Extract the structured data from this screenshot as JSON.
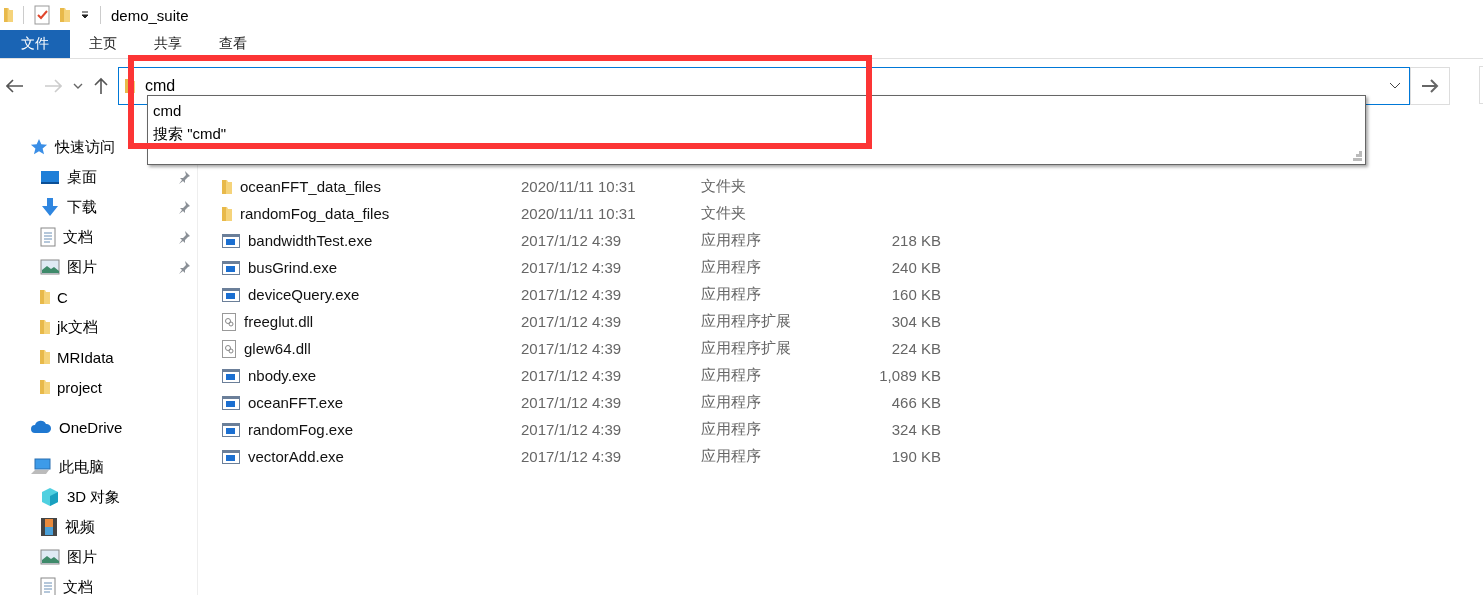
{
  "window": {
    "title": "demo_suite"
  },
  "ribbon_tabs": [
    {
      "label": "文件",
      "kind": "file"
    },
    {
      "label": "主页",
      "kind": "tab"
    },
    {
      "label": "共享",
      "kind": "tab"
    },
    {
      "label": "查看",
      "kind": "tab"
    }
  ],
  "address_bar": {
    "value": "cmd",
    "suggestions": [
      "cmd",
      "搜索 \"cmd\""
    ]
  },
  "sidebar": [
    {
      "label": "快速访问",
      "kind": "star",
      "children": [
        {
          "label": "桌面",
          "kind": "desktop",
          "pinned": true
        },
        {
          "label": "下载",
          "kind": "download",
          "pinned": true
        },
        {
          "label": "文档",
          "kind": "document",
          "pinned": true
        },
        {
          "label": "图片",
          "kind": "pictures",
          "pinned": true
        },
        {
          "label": "C",
          "kind": "folder"
        },
        {
          "label": "jk文档",
          "kind": "folder"
        },
        {
          "label": "MRIdata",
          "kind": "folder"
        },
        {
          "label": "project",
          "kind": "folder"
        }
      ]
    },
    {
      "label": "OneDrive",
      "kind": "cloud"
    },
    {
      "label": "此电脑",
      "kind": "computer",
      "children": [
        {
          "label": "3D 对象",
          "kind": "cube"
        },
        {
          "label": "视频",
          "kind": "video"
        },
        {
          "label": "图片",
          "kind": "pictures"
        },
        {
          "label": "文档",
          "kind": "document"
        }
      ]
    }
  ],
  "files": [
    {
      "name": "oceanFFT_data_files",
      "date": "2020/11/11 10:31",
      "type": "文件夹",
      "kind": "folder"
    },
    {
      "name": "randomFog_data_files",
      "date": "2020/11/11 10:31",
      "type": "文件夹",
      "kind": "folder"
    },
    {
      "name": "bandwidthTest.exe",
      "date": "2017/1/12 4:39",
      "type": "应用程序",
      "size": "218 KB",
      "kind": "exe"
    },
    {
      "name": "busGrind.exe",
      "date": "2017/1/12 4:39",
      "type": "应用程序",
      "size": "240 KB",
      "kind": "exe"
    },
    {
      "name": "deviceQuery.exe",
      "date": "2017/1/12 4:39",
      "type": "应用程序",
      "size": "160 KB",
      "kind": "exe"
    },
    {
      "name": "freeglut.dll",
      "date": "2017/1/12 4:39",
      "type": "应用程序扩展",
      "size": "304 KB",
      "kind": "dll"
    },
    {
      "name": "glew64.dll",
      "date": "2017/1/12 4:39",
      "type": "应用程序扩展",
      "size": "224 KB",
      "kind": "dll"
    },
    {
      "name": "nbody.exe",
      "date": "2017/1/12 4:39",
      "type": "应用程序",
      "size": "1,089 KB",
      "kind": "exe"
    },
    {
      "name": "oceanFFT.exe",
      "date": "2017/1/12 4:39",
      "type": "应用程序",
      "size": "466 KB",
      "kind": "exe"
    },
    {
      "name": "randomFog.exe",
      "date": "2017/1/12 4:39",
      "type": "应用程序",
      "size": "324 KB",
      "kind": "exe"
    },
    {
      "name": "vectorAdd.exe",
      "date": "2017/1/12 4:39",
      "type": "应用程序",
      "size": "190 KB",
      "kind": "exe"
    }
  ]
}
